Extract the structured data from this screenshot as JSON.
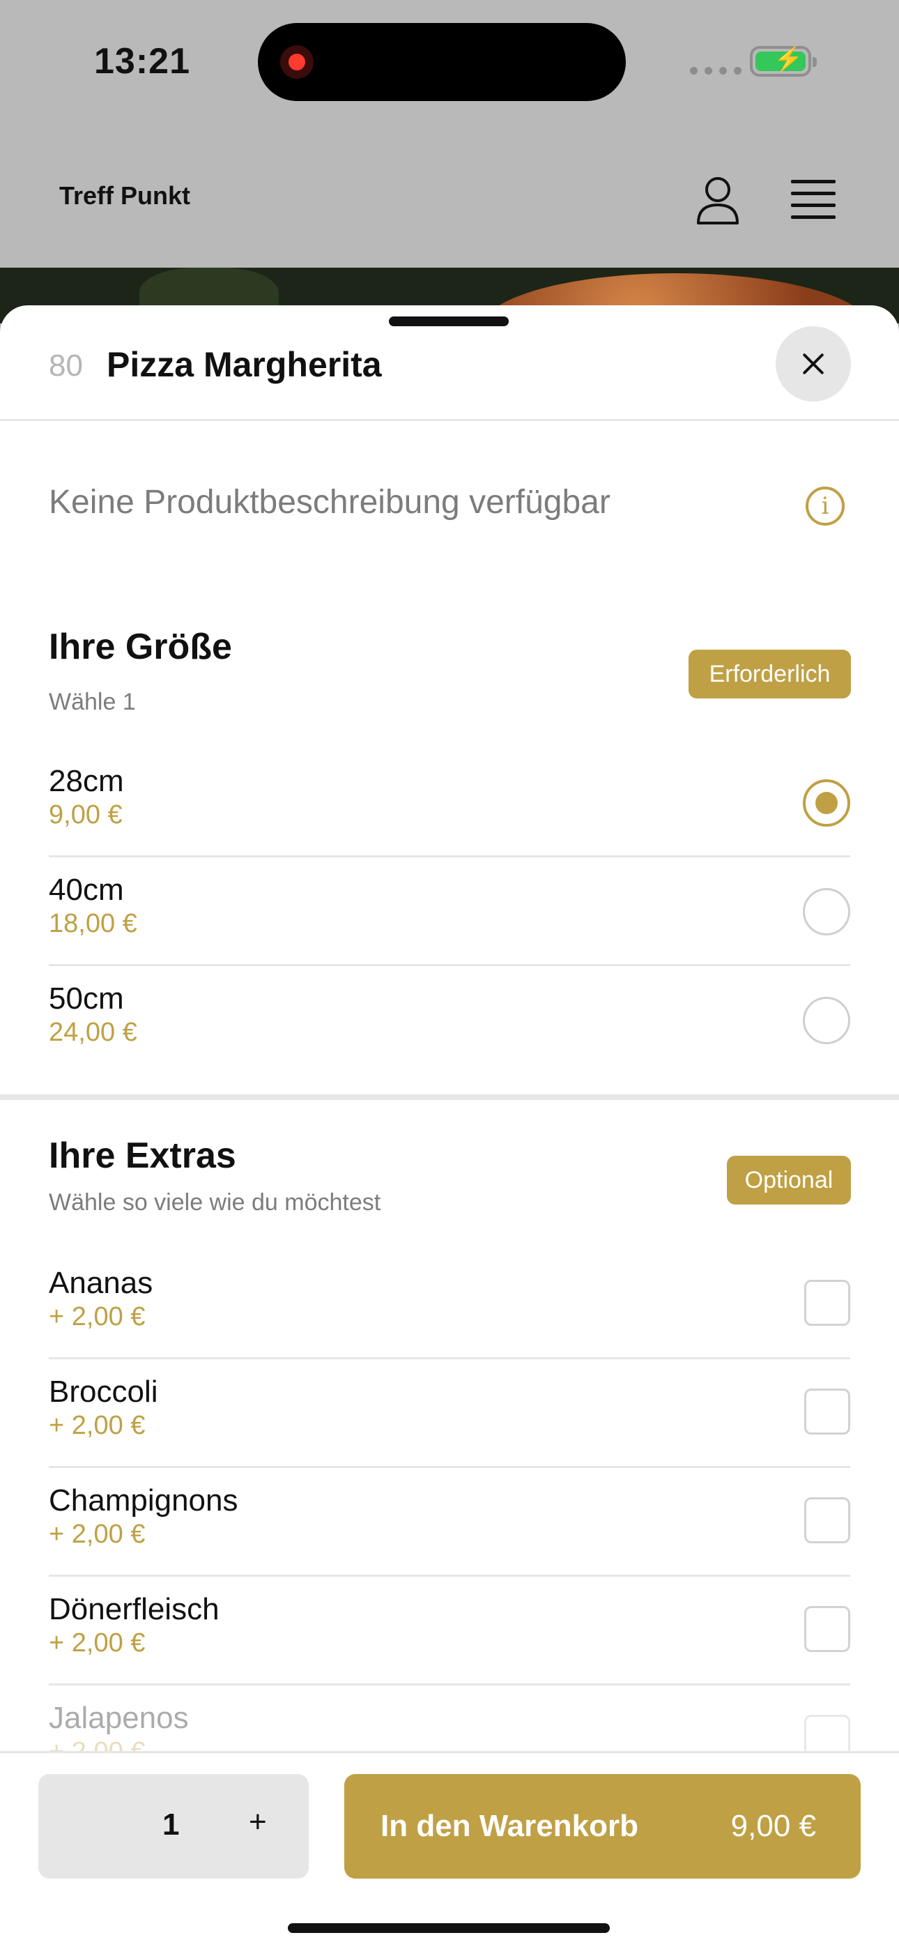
{
  "status_bar": {
    "time": "13:21"
  },
  "app_header": {
    "brand": "Treff Punkt",
    "icons": [
      "user-icon",
      "menu-icon"
    ]
  },
  "product": {
    "number": "80",
    "name": "Pizza Margherita",
    "description": "Keine Produktbeschreibung verfügbar"
  },
  "size_section": {
    "title": "Ihre Größe",
    "subtitle": "Wähle 1",
    "badge": "Erforderlich",
    "options": [
      {
        "name": "28cm",
        "price": "9,00 €",
        "selected": true
      },
      {
        "name": "40cm",
        "price": "18,00 €",
        "selected": false
      },
      {
        "name": "50cm",
        "price": "24,00 €",
        "selected": false
      }
    ]
  },
  "extras_section": {
    "title": "Ihre Extras",
    "subtitle": "Wähle so viele wie du möchtest",
    "badge": "Optional",
    "options": [
      {
        "name": "Ananas",
        "price": "+ 2,00 €"
      },
      {
        "name": "Broccoli",
        "price": "+ 2,00 €"
      },
      {
        "name": "Champignons",
        "price": "+ 2,00 €"
      },
      {
        "name": "Dönerfleisch",
        "price": "+ 2,00 €"
      },
      {
        "name": "Jalapenos",
        "price": "+ 2,00 €"
      }
    ]
  },
  "cart_bar": {
    "quantity": "1",
    "plus": "+",
    "button_label": "In den Warenkorb",
    "total": "9,00 €"
  },
  "colors": {
    "accent": "#bfa044",
    "overlay": "#b9b9b9",
    "battery": "#34c759"
  }
}
